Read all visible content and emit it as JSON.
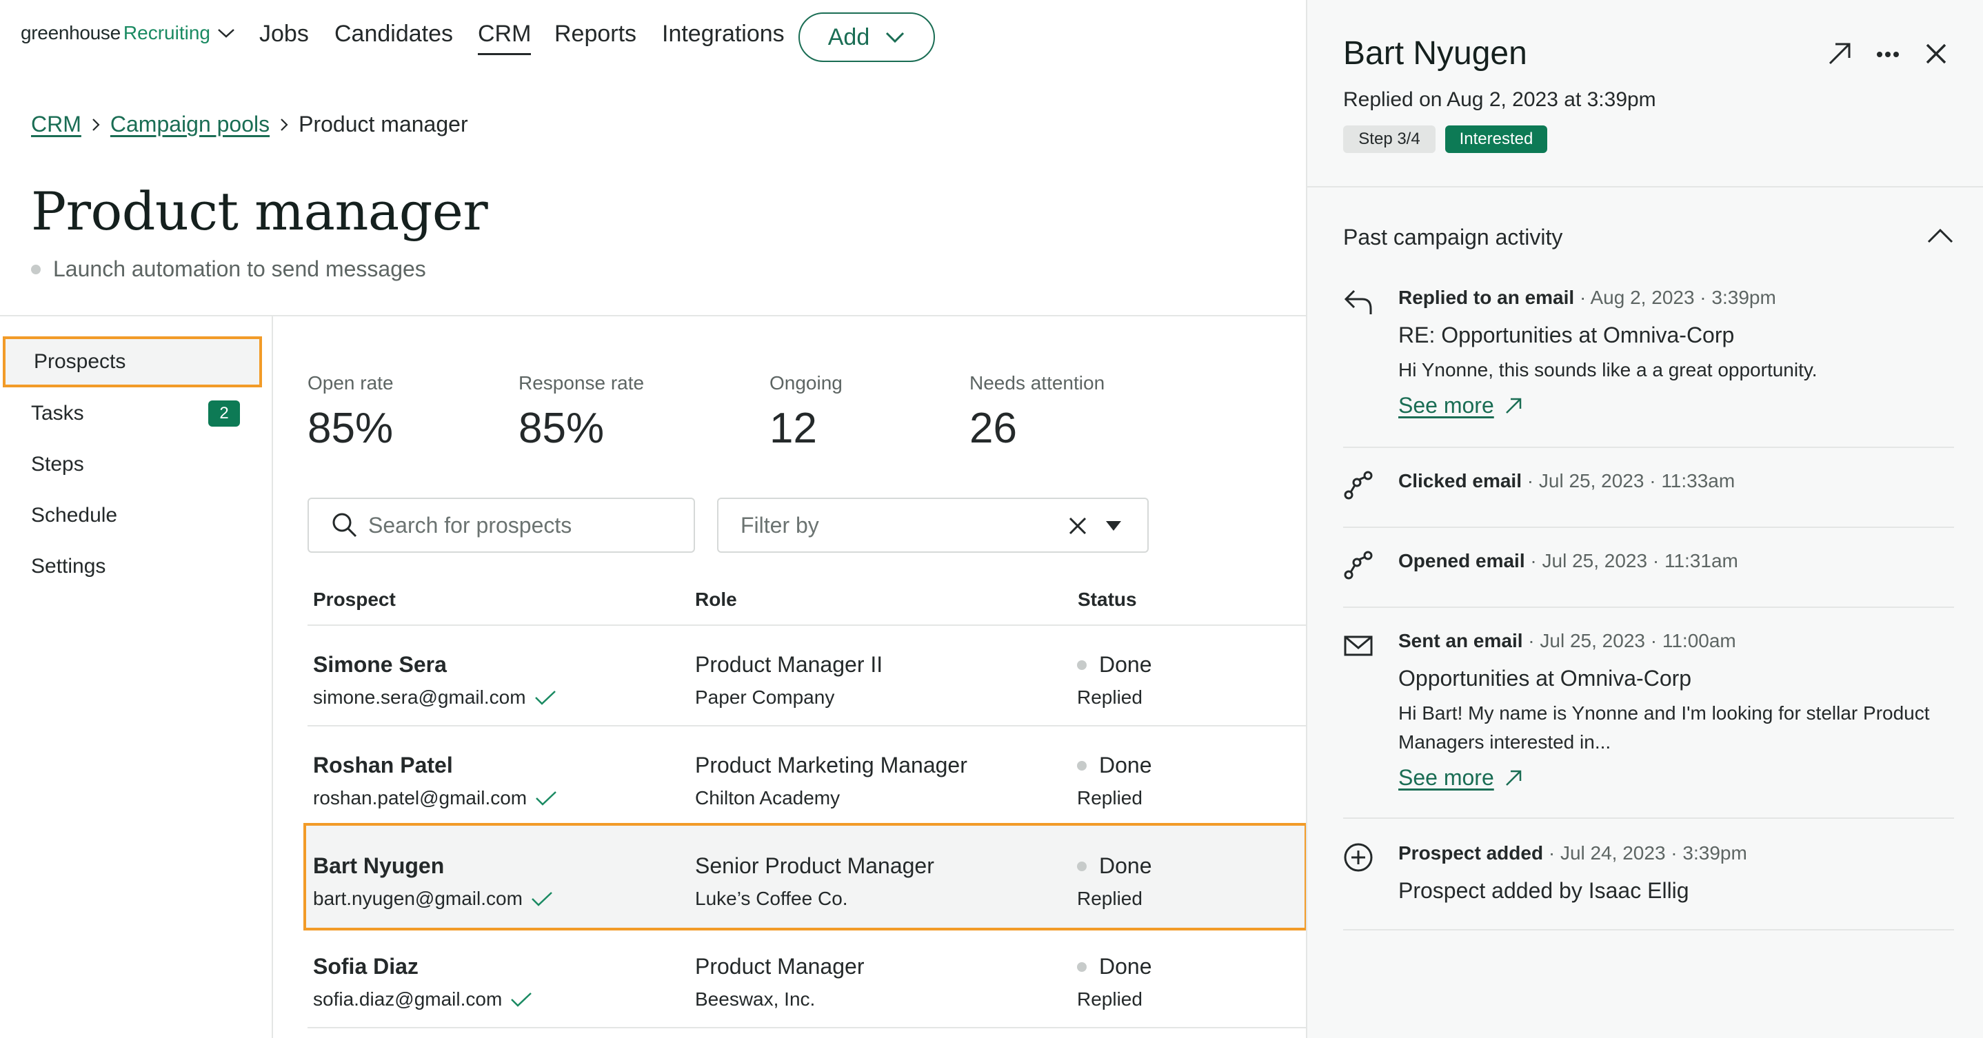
{
  "nav": {
    "logo_brand": "greenhouse",
    "logo_product": "Recruiting",
    "items": [
      "Jobs",
      "Candidates",
      "CRM",
      "Reports",
      "Integrations"
    ],
    "active": "CRM",
    "add_label": "Add"
  },
  "breadcrumb": {
    "crm": "CRM",
    "pools": "Campaign pools",
    "current": "Product manager"
  },
  "page": {
    "title": "Product manager",
    "status": "Launch automation to send messages"
  },
  "sidebar": {
    "items": [
      {
        "label": "Prospects",
        "selected": true
      },
      {
        "label": "Tasks",
        "badge": "2"
      },
      {
        "label": "Steps"
      },
      {
        "label": "Schedule"
      },
      {
        "label": "Settings"
      }
    ]
  },
  "metrics": [
    {
      "label": "Open rate",
      "value": "85%"
    },
    {
      "label": "Response rate",
      "value": "85%"
    },
    {
      "label": "Ongoing",
      "value": "12"
    },
    {
      "label": "Needs attention",
      "value": "26"
    }
  ],
  "search": {
    "placeholder": "Search for prospects"
  },
  "filter": {
    "placeholder": "Filter by"
  },
  "table": {
    "headers": [
      "Prospect",
      "Role",
      "Status"
    ],
    "rows": [
      {
        "name": "Simone Sera",
        "email": "simone.sera@gmail.com",
        "role": "Product Manager II",
        "company": "Paper Company",
        "status": "Done",
        "substatus": "Replied"
      },
      {
        "name": "Roshan Patel",
        "email": "roshan.patel@gmail.com",
        "role": "Product Marketing Manager",
        "company": "Chilton Academy",
        "status": "Done",
        "substatus": "Replied"
      },
      {
        "name": "Bart Nyugen",
        "email": "bart.nyugen@gmail.com",
        "role": "Senior Product Manager",
        "company": "Luke’s Coffee Co.",
        "status": "Done",
        "substatus": "Replied",
        "selected": true
      },
      {
        "name": "Sofia Diaz",
        "email": "sofia.diaz@gmail.com",
        "role": "Product Manager",
        "company": "Beeswax, Inc.",
        "status": "Done",
        "substatus": "Replied"
      }
    ]
  },
  "panel": {
    "name": "Bart Nyugen",
    "replied": "Replied on Aug 2, 2023 at 3:39pm",
    "step": "Step 3/4",
    "tag": "Interested",
    "section_title": "Past campaign activity",
    "activities": [
      {
        "icon": "reply-icon",
        "action": "Replied to an email",
        "meta": " · Aug 2, 2023 · 3:39pm",
        "title": "RE: Opportunities at Omniva-Corp",
        "body": "Hi Ynonne, this sounds like a a great opportunity.",
        "link": "See more"
      },
      {
        "icon": "click-path-icon",
        "action": "Clicked email",
        "meta": " · Jul 25, 2023 · 11:33am"
      },
      {
        "icon": "click-path-icon",
        "action": "Opened email",
        "meta": " · Jul 25, 2023 · 11:31am"
      },
      {
        "icon": "envelope-icon",
        "action": "Sent an email",
        "meta": " · Jul 25, 2023 · 11:00am",
        "title": "Opportunities at Omniva-Corp",
        "body": "Hi Bart! My name is Ynonne and I'm looking for stellar Product Managers interested in...",
        "link": "See more"
      },
      {
        "icon": "plus-circle-icon",
        "action": "Prospect added",
        "meta": " · Jul 24, 2023 · 3:39pm",
        "title": "Prospect added by Isaac Ellig"
      }
    ]
  },
  "colors": {
    "brand_green": "#0d7a55",
    "link_green": "#1a6d54",
    "highlight": "#f29b28"
  }
}
